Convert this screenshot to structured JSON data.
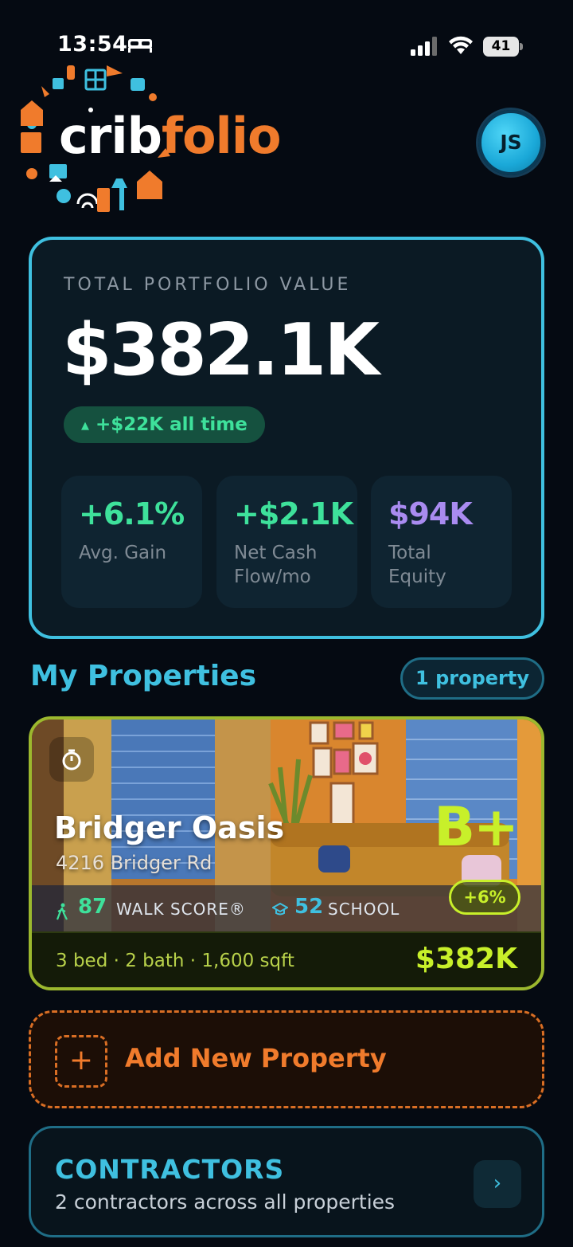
{
  "status_bar": {
    "time": "13:54",
    "battery": "41"
  },
  "header": {
    "logo_part1": "crib",
    "logo_part2": "folio",
    "avatar_initials": "JS"
  },
  "portfolio": {
    "label": "TOTAL PORTFOLIO VALUE",
    "value": "$382.1K",
    "change": "+$22K all time",
    "stats": [
      {
        "value": "+6.1%",
        "label": "Avg. Gain",
        "color": "#3ee19b"
      },
      {
        "value": "+$2.1K",
        "label": "Net Cash Flow/mo",
        "color": "#3ee19b"
      },
      {
        "value": "$94K",
        "label": "Total Equity",
        "color": "#a98bf0"
      }
    ]
  },
  "properties_section": {
    "title": "My Properties",
    "count": "1 property"
  },
  "property": {
    "name": "Bridger Oasis",
    "address": "4216 Bridger Rd",
    "grade": "B+",
    "walk_score": "87",
    "walk_label": "WALK SCORE®",
    "school_score": "52",
    "school_label": "SCHOOL",
    "change": "+6%",
    "details": "3 bed · 2 bath · 1,600 sqft",
    "price": "$382K"
  },
  "add_property": {
    "label": "Add New Property"
  },
  "contractors": {
    "title": "CONTRACTORS",
    "subtitle": "2 contractors across all properties"
  },
  "colors": {
    "accent_blue": "#3fc0e0",
    "accent_orange": "#f07b2c",
    "accent_green": "#3ee19b",
    "accent_lime": "#c8f02a",
    "accent_purple": "#a98bf0"
  }
}
